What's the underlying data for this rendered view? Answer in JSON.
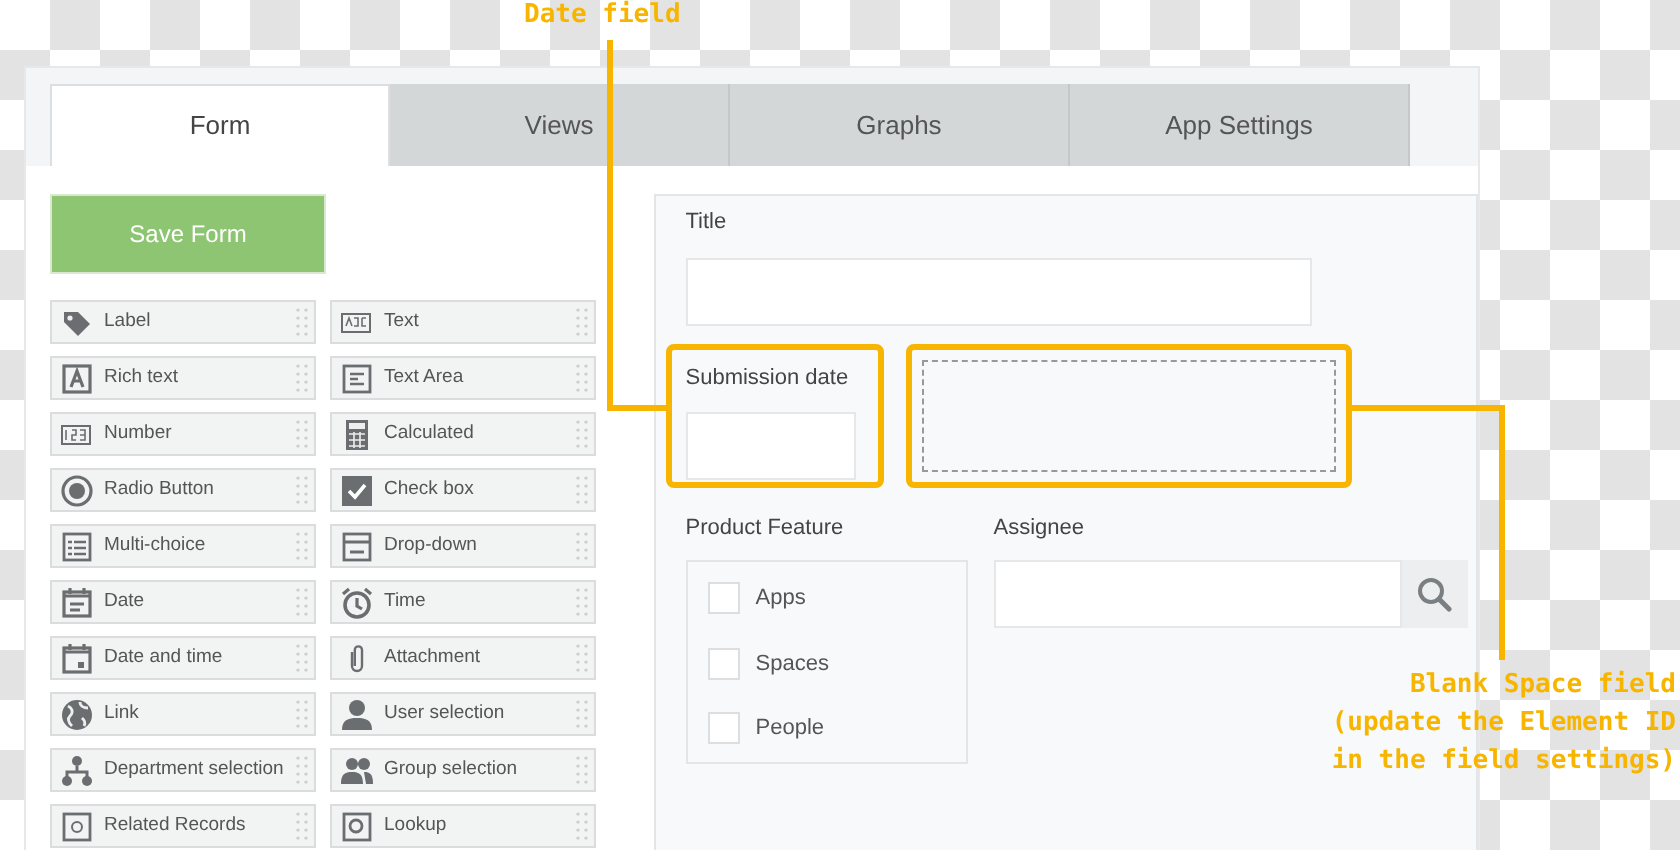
{
  "tabs": [
    {
      "label": "Form",
      "selected": true
    },
    {
      "label": "Views",
      "selected": false
    },
    {
      "label": "Graphs",
      "selected": false
    },
    {
      "label": "App Settings",
      "selected": false
    }
  ],
  "save_button": "Save Form",
  "palette": [
    "Label",
    "Text",
    "Rich text",
    "Text Area",
    "Number",
    "Calculated",
    "Radio Button",
    "Check box",
    "Multi-choice",
    "Drop-down",
    "Date",
    "Time",
    "Date and time",
    "Attachment",
    "Link",
    "User selection",
    "Department selection",
    "Group selection",
    "Related Records",
    "Lookup"
  ],
  "form": {
    "title_label": "Title",
    "date_label": "Submission date",
    "product_feature": {
      "label": "Product Feature",
      "options": [
        {
          "label": "Apps",
          "checked": false
        },
        {
          "label": "Spaces",
          "checked": false
        },
        {
          "label": "People",
          "checked": false
        }
      ]
    },
    "assignee_label": "Assignee"
  },
  "annotations": [
    {
      "kind": "date",
      "lines": [
        "Date field"
      ]
    },
    {
      "kind": "blank",
      "lines": [
        "Blank Space field",
        "(update the Element ID",
        "in the field settings)"
      ]
    }
  ]
}
